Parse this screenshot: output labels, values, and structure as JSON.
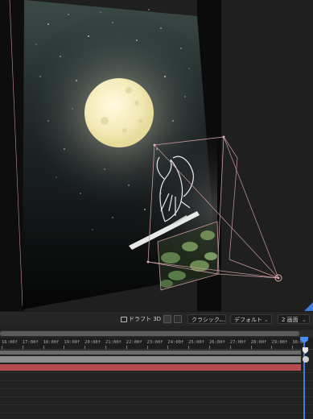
{
  "toolbar": {
    "draft3d_label": "ドラフト 3D",
    "renderer": "クラシック...",
    "camera": "デフォルト",
    "views": "2 画面"
  },
  "timeline": {
    "ticks": [
      "16:00f",
      "17:00f",
      "18:00f",
      "19:00f",
      "20:00f",
      "21:00f",
      "22:00f",
      "23:00f",
      "24:00f",
      "25:00f",
      "26:00f",
      "27:00f",
      "28:00f",
      "29:00f",
      "30:00"
    ]
  },
  "colors": {
    "layer_red": "#b44b50",
    "layer_gray": "#8c8c8c",
    "playhead": "#3f7ddc",
    "camera_wire": "#c99aa0"
  },
  "icons": [
    "draft-3d-icon",
    "view-toggle-icon",
    "chevron-down-icon",
    "playhead-icon",
    "end-marker-icon",
    "gear-icon"
  ]
}
